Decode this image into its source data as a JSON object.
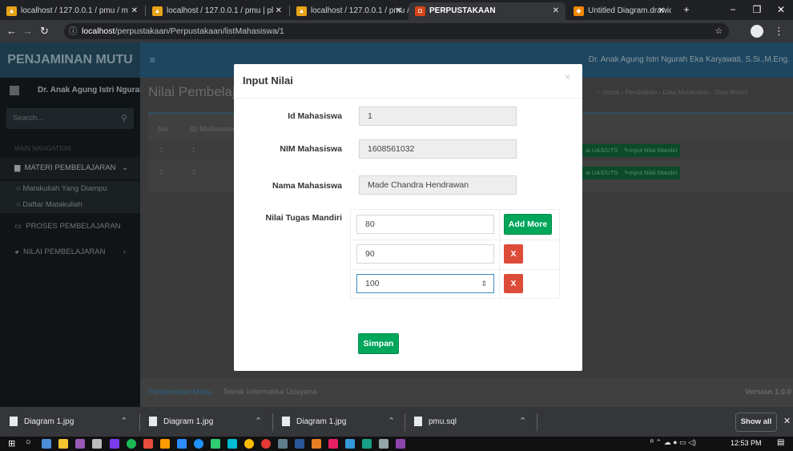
{
  "browser": {
    "tabs": [
      {
        "title": "localhost / 127.0.0.1 / pmu / m",
        "favicon": "phpmyadmin-icon",
        "active": false
      },
      {
        "title": "localhost / 127.0.0.1 / pmu | pl",
        "favicon": "phpmyadmin-icon",
        "active": false
      },
      {
        "title": "localhost / 127.0.0.1 / pmu / m",
        "favicon": "phpmyadmin-icon",
        "active": false
      },
      {
        "title": "PERPUSTAKAAN",
        "favicon": "codeigniter-icon",
        "active": true
      },
      {
        "title": "Untitled Diagram.drawio - draw",
        "favicon": "drawio-icon",
        "active": false
      }
    ],
    "new_tab": "+",
    "address_host": "localhost",
    "address_path": "/perpustakaan/Perpustakaan/listMahasiswa/1"
  },
  "app": {
    "brand": "PENJAMINAN MUTU",
    "user_name": "Dr. Anak Agung Istri Ngurah Eka Karyawati, S.Si.,M.Eng.",
    "sidebar_user": "Dr. Anak Agung Istri Ngurah",
    "search_placeholder": "Search...",
    "main_nav_heading": "MAIN NAVIGATION",
    "menu": [
      {
        "label": "MATERI PEMBELAJARAN",
        "icon": "book-icon"
      },
      {
        "label": "Matakuliah Yang Diampu",
        "icon": "circle-icon"
      },
      {
        "label": "Daftar Matakuliah",
        "icon": "circle-icon"
      },
      {
        "label": "PROSES PEMBELAJARAN",
        "icon": "laptop-icon"
      },
      {
        "label": "NILAI PEMBELAJARAN",
        "icon": "chart-icon"
      }
    ],
    "page_title": "Nilai Pembelaj",
    "breadcrumb": [
      "Home",
      "Pendidikan",
      "Data Matakuliah",
      "Data Materi"
    ],
    "table_headers": [
      "No",
      "ID Mahasisw"
    ],
    "rows": [
      {
        "no": "1",
        "id": "1"
      },
      {
        "no": "2",
        "id": "3"
      }
    ],
    "row_actions": [
      "ai UAS/UTS",
      "Input Nilai Mandiri"
    ],
    "footer_brand": "Penjaminan Mutu.",
    "footer_text": "Teknik Informatika Udayana",
    "footer_version": "Version 1.0.0"
  },
  "modal": {
    "title": "Input Nilai",
    "close": "×",
    "fields": [
      {
        "label": "Id Mahasiswa",
        "value": "1"
      },
      {
        "label": "NIM Mahasiswa",
        "value": "1608561032"
      },
      {
        "label": "Nama Mahasiswa",
        "value": "Made Chandra Hendrawan"
      }
    ],
    "tugas_label": "Nilai Tugas Mandiri",
    "tugas_values": [
      "80",
      "90",
      "100"
    ],
    "add_more": "Add More",
    "remove": "X",
    "submit": "Simpan"
  },
  "downloads": {
    "items": [
      "Diagram 1.jpg",
      "Diagram 1.jpg",
      "Diagram 1.jpg",
      "pmu.sql"
    ],
    "show_all": "Show all"
  },
  "taskbar": {
    "time": "12:53 PM"
  }
}
